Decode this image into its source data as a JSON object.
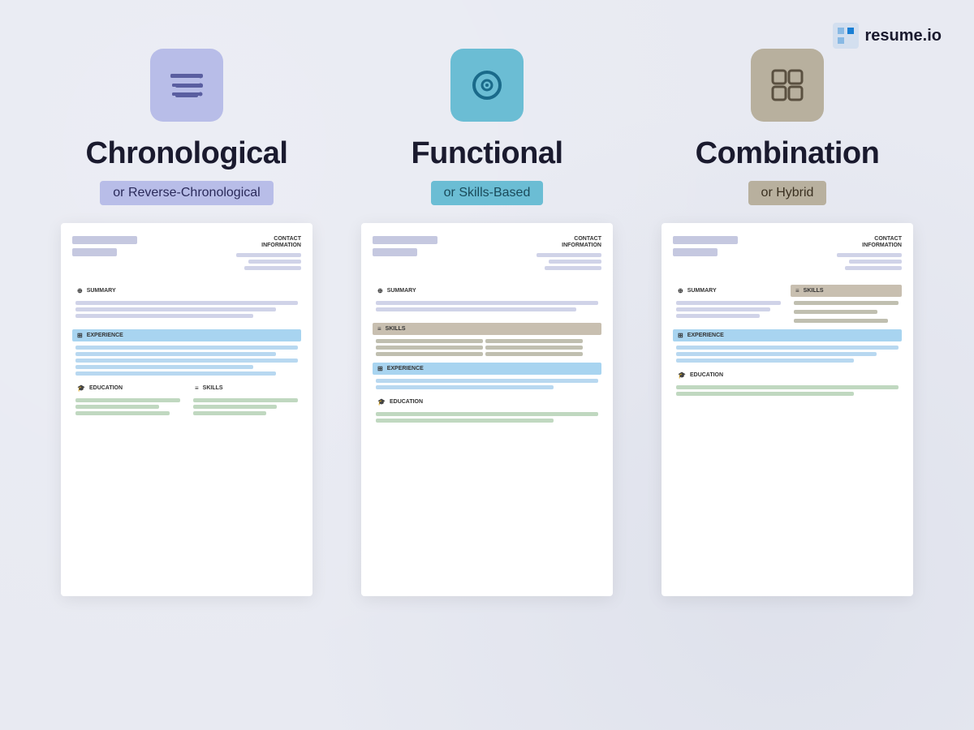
{
  "logo": {
    "text": "resume.io"
  },
  "columns": [
    {
      "id": "chronological",
      "icon_label": "chronological-icon",
      "title": "Chronological",
      "subtitle": "or Reverse-Chronological",
      "sections": [
        "SUMMARY",
        "EXPERIENCE",
        "EDUCATION",
        "SKILLS"
      ]
    },
    {
      "id": "functional",
      "icon_label": "functional-icon",
      "title": "Functional",
      "subtitle": "or Skills-Based",
      "sections": [
        "SUMMARY",
        "SKILLS",
        "EXPERIENCE",
        "EDUCATION"
      ]
    },
    {
      "id": "combination",
      "icon_label": "combination-icon",
      "title": "Combination",
      "subtitle": "or Hybrid",
      "sections": [
        "SUMMARY",
        "SKILLS",
        "EXPERIENCE",
        "EDUCATION"
      ]
    }
  ],
  "contact_label": "CONTACT\nINFORMATION",
  "section_labels": {
    "summary": "SUMMARY",
    "experience": "EXPERIENCE",
    "education": "EDUCATION",
    "skills": "SKILLS"
  }
}
